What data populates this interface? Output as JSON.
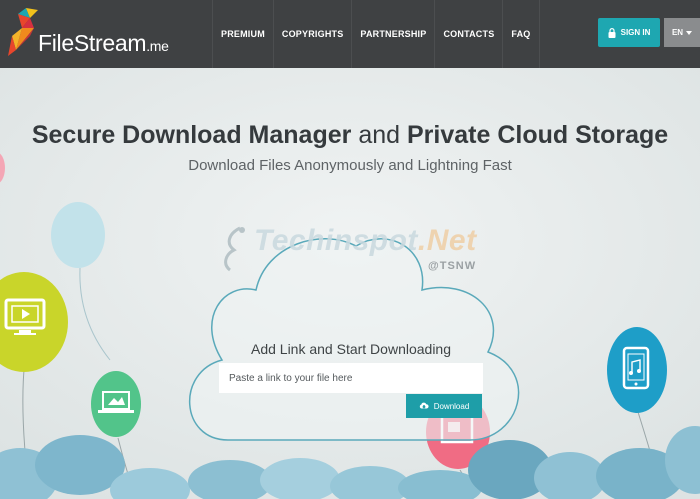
{
  "header": {
    "logo_name": "FileStream",
    "logo_suffix": ".me",
    "nav": [
      {
        "label": "PREMIUM"
      },
      {
        "label": "COPYRIGHTS"
      },
      {
        "label": "PARTNERSHIP"
      },
      {
        "label": "CONTACTS"
      },
      {
        "label": "FAQ"
      }
    ],
    "signin_label": "SIGN IN",
    "language": "EN"
  },
  "hero": {
    "title_bold_1": "Secure Download Manager",
    "title_light": " and ",
    "title_bold_2": "Private Cloud Storage",
    "subtitle": "Download Files Anonymously and Lightning Fast"
  },
  "watermark": {
    "name": "Techinspot",
    "suffix": ".Net",
    "tag": "@TSNW"
  },
  "download_box": {
    "heading": "Add Link and Start Downloading",
    "placeholder": "Paste a link to your file here",
    "button_label": "Download"
  },
  "colors": {
    "header_bg": "#3f4143",
    "accent": "#1ea7b1",
    "page_bg": "#e8ecec",
    "balloon_yellow": "#c9d52a",
    "balloon_green": "#52c48a",
    "balloon_pink": "#f06c84",
    "balloon_blue": "#1e9ec8",
    "balloon_light": "#bfe3ec"
  }
}
